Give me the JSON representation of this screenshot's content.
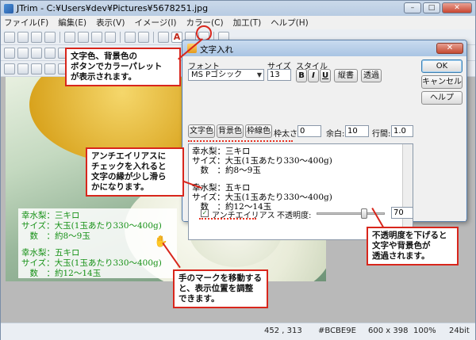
{
  "app": {
    "title": "JTrim - C:¥Users¥dev¥Pictures¥5678251.jpg",
    "menu": [
      "ファイル(F)",
      "編集(E)",
      "表示(V)",
      "イメージ(I)",
      "カラー(C)",
      "加工(T)",
      "ヘルプ(H)"
    ]
  },
  "photo_overlay": {
    "lines": [
      "幸水梨：三キロ",
      "サイズ：大玉(1玉あたり330～400g)",
      "　数　：約8～9玉",
      "",
      "幸水梨：五キロ",
      "サイズ：大玉(1玉あたり330～400g)",
      "　数　：約12～14玉"
    ]
  },
  "dialog": {
    "title": "文字入れ",
    "font_label": "フォント",
    "font_value": "MS Pゴシック",
    "size_label": "サイズ",
    "size_value": "13",
    "style_label": "スタイル",
    "bold": "B",
    "italic": "I",
    "underline": "U",
    "vertical_button": "縦書",
    "transparent_button": "透過",
    "text_color_button": "文字色",
    "bg_color_button": "背景色",
    "border_color_button": "枠線色",
    "border_width_label": "枠太さ:",
    "border_width_value": "0",
    "margin_label": "余白:",
    "margin_value": "10",
    "line_spacing_label": "行間:",
    "line_spacing_value": "1.0",
    "ok_button": "OK",
    "cancel_button": "キャンセル",
    "help_button": "ヘルプ",
    "preview_lines": [
      "幸水梨：三キロ",
      "サイズ：大玉(1玉あたり330～400g)",
      "　数　：約8～9玉",
      "",
      "幸水梨：五キロ",
      "サイズ：大玉(1玉あたり330～400g)",
      "　数　：約12～14玉"
    ],
    "antialias_label": "アンチエイリアス",
    "opacity_label": "不透明度:",
    "opacity_value": "70"
  },
  "status": {
    "coords": "452 , 313",
    "color": "#BCBE9E",
    "dimensions": "600 x 398",
    "zoom": "100%",
    "bits": "24bit"
  },
  "callouts": {
    "color_buttons": "文字色、背景色の\nボタンでカラーパレット\nが表示されます。",
    "antialias": "アンチエイリアスに\nチェックを入れると\n文字の縁が少し滑ら\nかになります。",
    "hand": "手のマークを移動する\nと、表示位置を調整\nできます。",
    "opacity": "不透明度を下げると\n文字や背景色が\n透過されます。"
  },
  "colors": {
    "callout_border": "#d8261c",
    "overlay_text": "#159015"
  },
  "icons": {
    "hand": "hand-cursor-icon",
    "text_tool": "text-a-icon"
  }
}
